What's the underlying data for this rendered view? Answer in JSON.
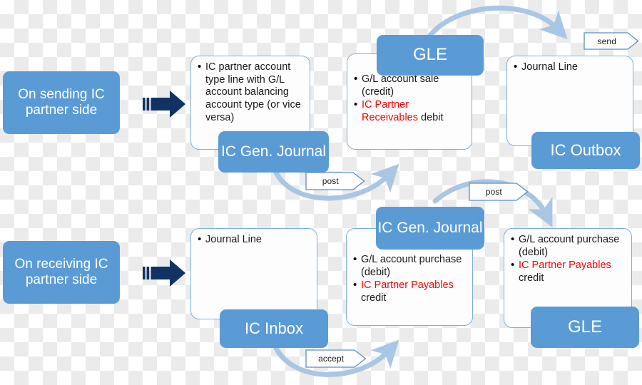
{
  "diagram": {
    "title": "Intercompany posting flow",
    "colors": {
      "blue_fill": "#5b9bd5",
      "card_border": "#7fb0dd",
      "curve_arrow": "#a9c6e4",
      "navy_arrow": "#103361",
      "highlight_red": "#ff0000"
    },
    "rows": [
      {
        "side_label": "On sending IC partner side",
        "cards": [
          {
            "header": "IC Gen. Journal",
            "bullets": [
              {
                "text": "IC partner account type line with G/L account balancing account type (or vice versa)",
                "highlight": ""
              }
            ]
          },
          {
            "header": "GLE",
            "bullets": [
              {
                "text": " G/L account sale (credit)",
                "highlight": ""
              },
              {
                "text": "IC Partner Receivables",
                "highlight": "IC Partner Receivables",
                "suffix": " debit"
              }
            ]
          },
          {
            "header": "IC Outbox",
            "bullets": [
              {
                "text": "Journal Line",
                "highlight": ""
              }
            ]
          }
        ]
      },
      {
        "side_label": "On receiving IC partner side",
        "cards": [
          {
            "header": "IC Inbox",
            "bullets": [
              {
                "text": "Journal Line",
                "highlight": ""
              }
            ]
          },
          {
            "header": "IC Gen. Journal",
            "bullets": [
              {
                "text": "G/L account purchase (debit)",
                "highlight": ""
              },
              {
                "text": " IC Partner Payables",
                "highlight": "IC Partner Payables",
                "suffix": " credit"
              }
            ]
          },
          {
            "header": "GLE",
            "bullets": [
              {
                "text": "G/L account purchase (debit)",
                "highlight": ""
              },
              {
                "text": " IC Partner Payables",
                "highlight": "IC Partner Payables",
                "suffix": " credit"
              }
            ]
          }
        ]
      }
    ],
    "labels": {
      "side_sending": "On sending IC partner side",
      "side_receiving": "On receiving IC partner side",
      "ic_gen_journal_top": "IC Gen. Journal",
      "gle_top": "GLE",
      "ic_outbox": "IC Outbox",
      "ic_inbox": "IC Inbox",
      "ic_gen_journal_bottom": "IC Gen. Journal",
      "gle_bottom": "GLE"
    },
    "cards_text": {
      "top_journal_bullet": "IC partner account type line with G/L account balancing account type (or vice versa)",
      "top_gle_bullet1": " G/L account sale (credit)",
      "top_gle_bullet2_red": "IC Partner Receivables",
      "top_gle_bullet2_rest": " debit",
      "top_outbox_bullet": "Journal Line",
      "bottom_inbox_bullet": "Journal Line",
      "bottom_journal_bullet1": "G/L account purchase (debit)",
      "bottom_journal_bullet2_red": " IC Partner Payables",
      "bottom_journal_bullet2_rest": " credit",
      "bottom_gle_bullet1": "G/L account purchase (debit)",
      "bottom_gle_bullet2_red": " IC Partner Payables",
      "bottom_gle_bullet2_rest": " credit"
    },
    "tags": {
      "send": "send",
      "post_top": "post",
      "post_bottom": "post",
      "accept": "accept"
    }
  }
}
